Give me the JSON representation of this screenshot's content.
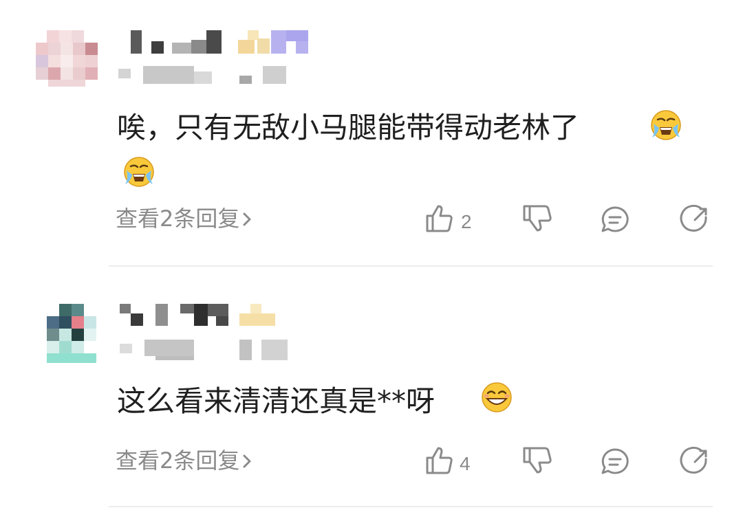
{
  "comments": [
    {
      "text_line1": "唉，只有无敌小马腿能带得动老林了",
      "emojis": [
        "crying-emoji",
        "crying-emoji"
      ],
      "replies_label": "查看2条回复",
      "likes": "2"
    },
    {
      "text_line1": "这么看来清清还真是**呀",
      "emojis": [
        "grin-emoji"
      ],
      "replies_label": "查看2条回复",
      "likes": "4"
    }
  ],
  "actions": {
    "like_icon": "thumb-up-icon",
    "dislike_icon": "thumb-down-icon",
    "comment_icon": "comment-bubble-icon",
    "share_icon": "share-icon"
  },
  "colors": {
    "text": "#1f1f1f",
    "muted": "#8a8a8a",
    "divider": "#ededed"
  }
}
